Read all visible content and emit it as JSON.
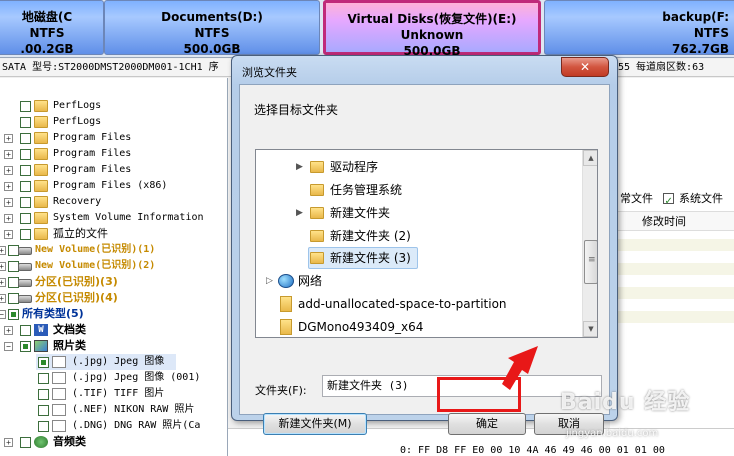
{
  "partitions": [
    {
      "name": "地磁盘(C",
      "fs": "NTFS",
      "size": ".00.2GB"
    },
    {
      "name": "Documents(D:)",
      "fs": "NTFS",
      "size": "500.0GB"
    },
    {
      "name": "Virtual Disks(恢复文件)(E:)",
      "fs": "Unknown",
      "size": "500.0GB"
    },
    {
      "name": "backup(F:",
      "fs": "NTFS",
      "size": "762.7GB"
    }
  ],
  "left_stub": "0",
  "disk_info": {
    "left": "SATA  型号:ST2000DMST2000DM001-1CH1  序",
    "right": "55  每道扇区数:63"
  },
  "tree": [
    {
      "label": "PerfLogs"
    },
    {
      "label": "PerfLogs"
    },
    {
      "label": "Program Files"
    },
    {
      "label": "Program Files"
    },
    {
      "label": "Program Files"
    },
    {
      "label": "Program Files (x86)"
    },
    {
      "label": "Recovery"
    },
    {
      "label": "System Volume Information"
    },
    {
      "label": "孤立的文件"
    },
    {
      "label": "New Volume(已识别)(1)"
    },
    {
      "label": "New Volume(已识别)(2)"
    },
    {
      "label": "分区(已识别)(3)"
    },
    {
      "label": "分区(已识别)(4)"
    },
    {
      "label": "所有类型(5)"
    },
    {
      "label": "文档类"
    },
    {
      "label": "照片类"
    },
    {
      "label": "(.jpg) Jpeg 图像"
    },
    {
      "label": "(.jpg) Jpeg 图像 (001)"
    },
    {
      "label": "(.TIF) TIFF 图片"
    },
    {
      "label": "(.NEF) NIKON RAW 照片"
    },
    {
      "label": "(.DNG) DNG RAW 照片(Ca"
    },
    {
      "label": "音频类"
    }
  ],
  "right_panel": {
    "normal_files": "常文件",
    "system_files": "系统文件",
    "modified_time": "修改时间"
  },
  "hex_text": "0:  FF D8 FF E0 00 10 4A 46 49 46 00 01 01 00",
  "dialog": {
    "title": "浏览文件夹",
    "close": "✕",
    "prompt": "选择目标文件夹",
    "folders": [
      "驱动程序",
      "任务管理系统",
      "新建文件夹",
      "新建文件夹 (2)",
      "新建文件夹 (3)",
      "网络",
      "add-unallocated-space-to-partition",
      "DGMono493409_x64"
    ],
    "folder_label": "文件夹(F):",
    "folder_value": "新建文件夹 (3)",
    "new_folder_btn": "新建文件夹(M)",
    "ok_btn": "确定",
    "cancel_btn": "取消"
  },
  "watermark": "Baidu 经验",
  "watermark_url": "jingyan.baidu.com"
}
